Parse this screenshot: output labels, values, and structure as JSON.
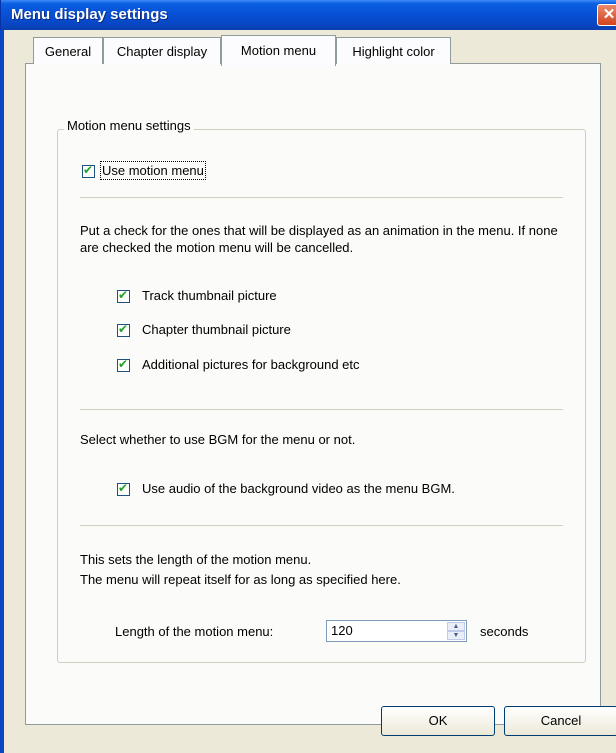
{
  "window": {
    "title": "Menu display settings"
  },
  "tabs": [
    {
      "label": "General"
    },
    {
      "label": "Chapter display"
    },
    {
      "label": "Motion menu"
    },
    {
      "label": "Highlight color"
    }
  ],
  "group": {
    "legend": "Motion menu settings",
    "use_motion_menu": {
      "label": "Use motion menu",
      "checked": true
    },
    "animation_note": "Put a check for the ones that will be displayed as an animation in the menu. If none are checked the motion menu will be cancelled.",
    "animation_items": [
      {
        "label": "Track thumbnail picture",
        "checked": true
      },
      {
        "label": "Chapter thumbnail picture",
        "checked": true
      },
      {
        "label": "Additional pictures for background etc",
        "checked": true
      }
    ],
    "bgm_note": "Select whether to use BGM for the menu or not.",
    "bgm_option": {
      "label": "Use audio of the background video as the menu BGM.",
      "checked": true
    },
    "length_note_1": "This sets the length of the motion menu.",
    "length_note_2": "The menu will repeat itself for as long as specified here.",
    "length_label": "Length of the motion menu:",
    "length_value": "120",
    "length_unit": "seconds"
  },
  "buttons": {
    "ok": "OK",
    "cancel": "Cancel"
  },
  "icons": {
    "close": "close-icon",
    "spin_up": "spin-up-icon",
    "spin_down": "spin-down-icon",
    "checkmark": "checkmark-icon"
  },
  "colors": {
    "titlebar": "#0851d6",
    "dialog_bg": "#ece9d8",
    "panel_bg": "#fbfbf9",
    "check": "#21a121"
  }
}
